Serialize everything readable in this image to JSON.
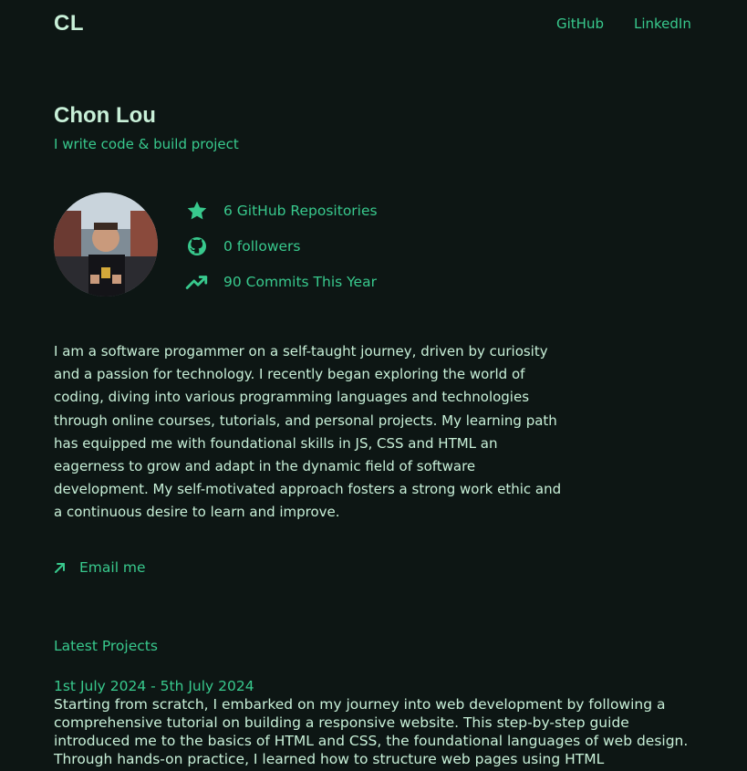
{
  "nav": {
    "logo": "CL",
    "links": [
      {
        "label": "GitHub"
      },
      {
        "label": "LinkedIn"
      }
    ]
  },
  "profile": {
    "name": "Chon Lou",
    "tagline": "I write code & build project"
  },
  "stats": [
    {
      "icon": "star-icon",
      "label": "6 GitHub Repositories"
    },
    {
      "icon": "github-icon",
      "label": "0 followers"
    },
    {
      "icon": "trending-up-icon",
      "label": "90 Commits This Year"
    }
  ],
  "bio": "I am a software progammer on a self-taught journey, driven by curiosity and a passion for technology. I recently began exploring the world of coding, diving into various programming languages and technologies through online courses, tutorials, and personal projects. My learning path has equipped me with foundational skills in JS, CSS and HTML an eagerness to grow and adapt in the dynamic field of software development. My self-motivated approach fosters a strong work ethic and a continuous desire to learn and improve.",
  "email": {
    "icon": "arrow-up-right-icon",
    "label": "Email me"
  },
  "projects": {
    "heading": "Latest Projects",
    "items": [
      {
        "date": "1st July 2024 - 5th July 2024",
        "description": "Starting from scratch, I embarked on my journey into web development by following a comprehensive tutorial on building a responsive website. This step-by-step guide introduced me to the basics of HTML and CSS, the foundational languages of web design. Through hands-on practice, I learned how to structure web pages using HTML"
      }
    ]
  },
  "colors": {
    "background": "#0d1614",
    "accent": "#38c98d",
    "text": "#c8f0d8"
  }
}
